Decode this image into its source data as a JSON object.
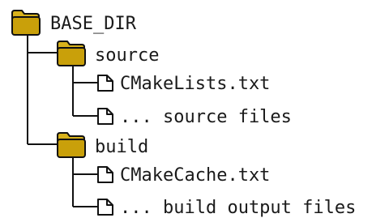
{
  "tree": {
    "root": {
      "label": "BASE_DIR",
      "icon": "folder-icon"
    },
    "folders": [
      {
        "label": "source",
        "icon": "folder-icon",
        "files": [
          {
            "label": "CMakeLists.txt",
            "icon": "file-icon"
          },
          {
            "label": "... source files",
            "icon": "file-icon"
          }
        ]
      },
      {
        "label": "build",
        "icon": "folder-icon",
        "files": [
          {
            "label": "CMakeCache.txt",
            "icon": "file-icon"
          },
          {
            "label": "... build output files",
            "icon": "file-icon"
          }
        ]
      }
    ]
  },
  "colors": {
    "folder_fill": "#c9a00a",
    "folder_tab": "#d8b21c",
    "folder_stroke": "#111111",
    "file_fill": "#ffffff",
    "file_stroke": "#111111",
    "line": "#111111",
    "text": "#1a1a1a"
  }
}
